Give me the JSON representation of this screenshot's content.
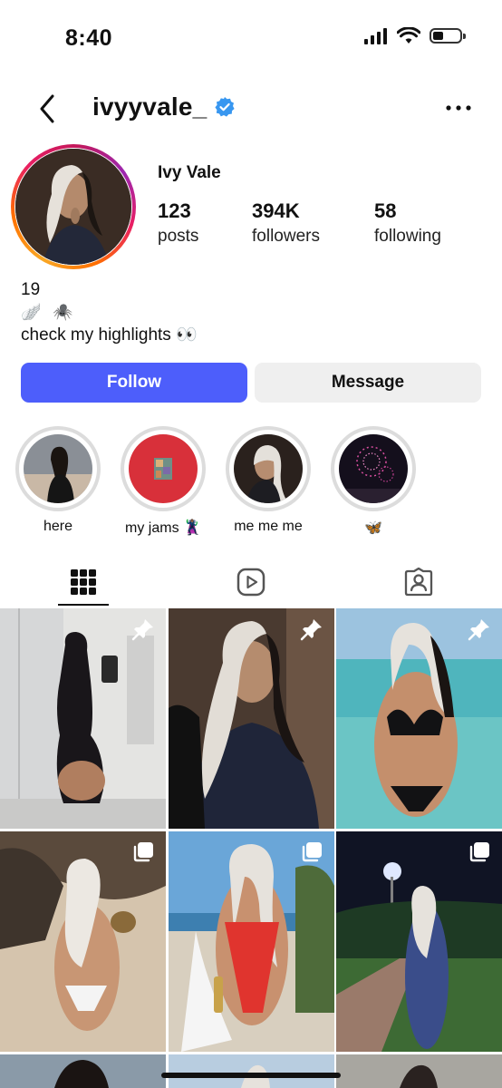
{
  "status_bar": {
    "time": "8:40",
    "battery_level": 0.35
  },
  "header": {
    "username": "ivyyvale_",
    "verified": true,
    "back_icon": "chevron-left-icon",
    "more_icon": "more-horizontal-icon"
  },
  "profile": {
    "display_name": "Ivy Vale",
    "stats": [
      {
        "value": "123",
        "label": "posts"
      },
      {
        "value": "394K",
        "label": "followers"
      },
      {
        "value": "58",
        "label": "following"
      }
    ],
    "bio": {
      "line1": "19",
      "line2": "🪽 🕷️",
      "line3": "check my highlights 👀"
    }
  },
  "actions": {
    "follow_label": "Follow",
    "message_label": "Message",
    "follow_color": "#4d5efb"
  },
  "highlights": [
    {
      "label": "here"
    },
    {
      "label": "my jams 🦹🏽‍♀️"
    },
    {
      "label": "me me me"
    },
    {
      "label": "🦋"
    }
  ],
  "tabs": [
    {
      "name": "grid",
      "icon": "grid-icon",
      "active": true
    },
    {
      "name": "reels",
      "icon": "reels-icon",
      "active": false
    },
    {
      "name": "tagged",
      "icon": "tagged-person-icon",
      "active": false
    }
  ],
  "posts": [
    {
      "badge": "pin-icon"
    },
    {
      "badge": "pin-icon"
    },
    {
      "badge": "pin-icon"
    },
    {
      "badge": "carousel-icon"
    },
    {
      "badge": "carousel-icon"
    },
    {
      "badge": "carousel-icon"
    }
  ]
}
